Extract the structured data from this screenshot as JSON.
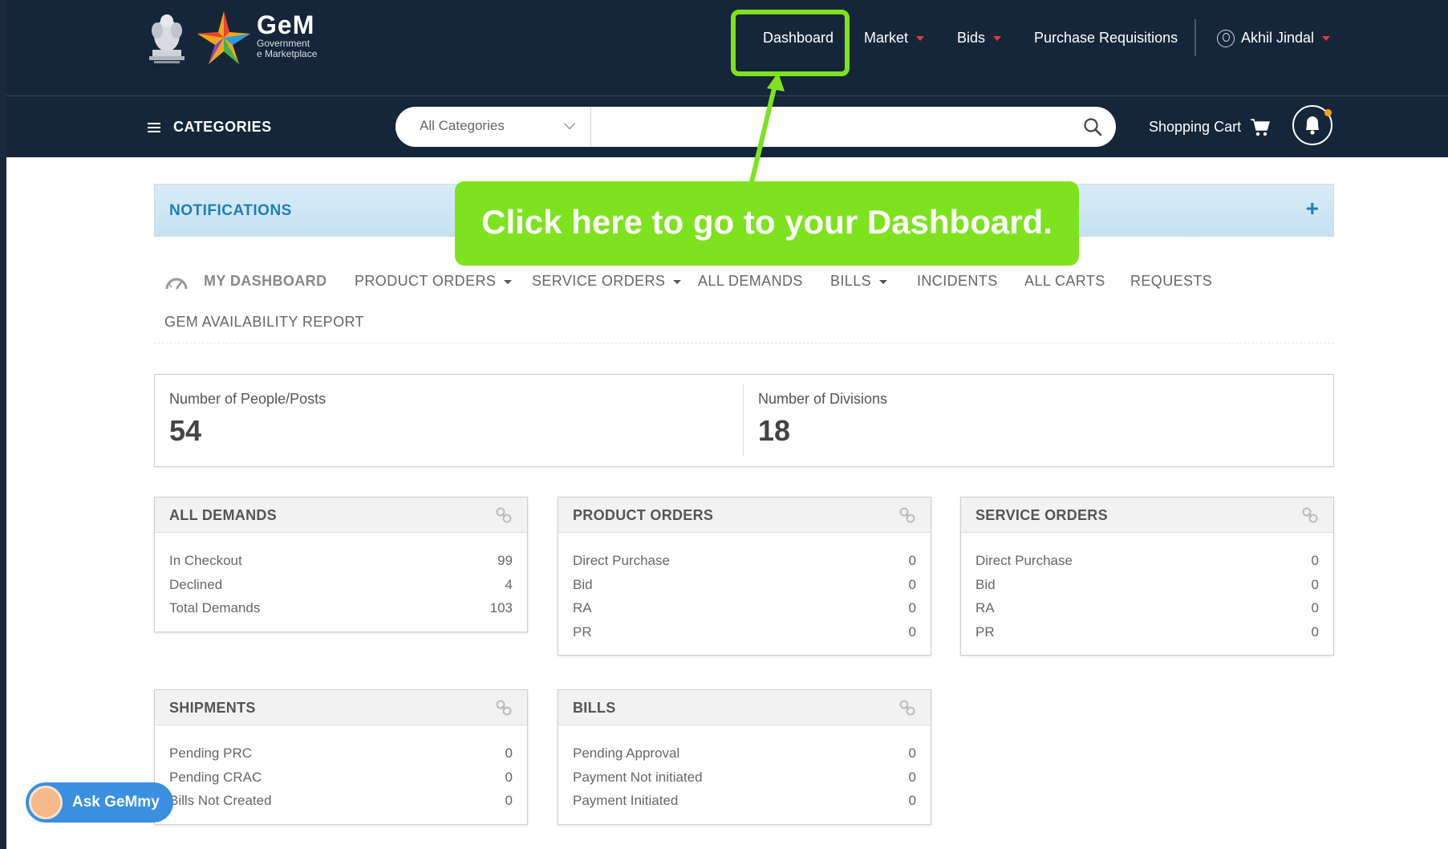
{
  "header": {
    "logo": {
      "title": "GeM",
      "line1": "Government",
      "line2": "e Marketplace"
    },
    "nav": {
      "dashboard": "Dashboard",
      "market": "Market",
      "bids": "Bids",
      "purchase_requisitions": "Purchase Requisitions",
      "user_name": "Akhil Jindal"
    }
  },
  "subbar": {
    "categories_label": "CATEGORIES",
    "search": {
      "category_selected": "All Categories",
      "placeholder": ""
    },
    "cart_label": "Shopping Cart"
  },
  "notifications": {
    "title": "NOTIFICATIONS",
    "expand": "+"
  },
  "callout": {
    "text": "Click here to go to your Dashboard."
  },
  "dashboard_nav": {
    "my_dashboard": "MY DASHBOARD",
    "product_orders": "PRODUCT ORDERS",
    "service_orders": "SERVICE ORDERS",
    "all_demands": "ALL DEMANDS",
    "bills": "BILLS",
    "incidents": "INCIDENTS",
    "all_carts": "ALL CARTS",
    "requests": "REQUESTS",
    "gem_availability_report": "GEM AVAILABILITY REPORT"
  },
  "stats": {
    "people": {
      "label": "Number of People/Posts",
      "value": "54"
    },
    "divisions": {
      "label": "Number of Divisions",
      "value": "18"
    }
  },
  "cards": {
    "all_demands": {
      "title": "ALL DEMANDS",
      "rows": [
        {
          "label": "In Checkout",
          "value": "99"
        },
        {
          "label": "Declined",
          "value": "4"
        },
        {
          "label": "Total Demands",
          "value": "103"
        }
      ]
    },
    "product_orders": {
      "title": "PRODUCT ORDERS",
      "rows": [
        {
          "label": "Direct Purchase",
          "value": "0"
        },
        {
          "label": "Bid",
          "value": "0"
        },
        {
          "label": "RA",
          "value": "0"
        },
        {
          "label": "PR",
          "value": "0"
        }
      ]
    },
    "service_orders": {
      "title": "SERVICE ORDERS",
      "rows": [
        {
          "label": "Direct Purchase",
          "value": "0"
        },
        {
          "label": "Bid",
          "value": "0"
        },
        {
          "label": "RA",
          "value": "0"
        },
        {
          "label": "PR",
          "value": "0"
        }
      ]
    },
    "shipments": {
      "title": "SHIPMENTS",
      "rows": [
        {
          "label": "Pending PRC",
          "value": "0"
        },
        {
          "label": "Pending CRAC",
          "value": "0"
        },
        {
          "label": "Bills Not Created",
          "value": "0"
        }
      ]
    },
    "bills": {
      "title": "BILLS",
      "rows": [
        {
          "label": "Pending Approval",
          "value": "0"
        },
        {
          "label": "Payment Not initiated",
          "value": "0"
        },
        {
          "label": "Payment Initiated",
          "value": "0"
        }
      ]
    }
  },
  "chat": {
    "label": "Ask GeMmy"
  },
  "colors": {
    "header_bg": "#16263a",
    "highlight": "#7ee21f",
    "accent_red": "#e83a3a",
    "notif_blue": "#1d7fb5"
  },
  "icons": [
    "national-emblem-icon",
    "gem-star-logo-icon",
    "user-circle-icon",
    "hamburger-icon",
    "chevron-down-icon",
    "search-icon",
    "cart-icon",
    "bell-icon",
    "gauge-icon",
    "link-icon",
    "gemmy-avatar-icon"
  ]
}
